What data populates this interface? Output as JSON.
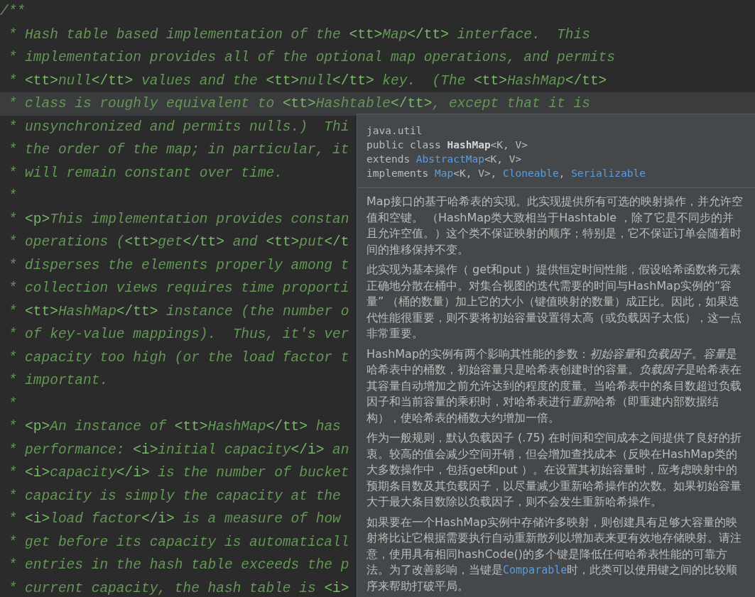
{
  "editor": {
    "lines": [
      {
        "current": false,
        "segments": [
          {
            "kind": "text",
            "text": "/**"
          }
        ]
      },
      {
        "current": false,
        "segments": [
          {
            "kind": "text",
            "text": " * Hash table based implementation of the "
          },
          {
            "kind": "tag",
            "text": "<tt>"
          },
          {
            "kind": "text",
            "text": "Map"
          },
          {
            "kind": "tag",
            "text": "</tt>"
          },
          {
            "kind": "text",
            "text": " interface.  This"
          }
        ]
      },
      {
        "current": false,
        "segments": [
          {
            "kind": "text",
            "text": " * implementation provides all of the optional map operations, and permits"
          }
        ]
      },
      {
        "current": false,
        "segments": [
          {
            "kind": "text",
            "text": " * "
          },
          {
            "kind": "tag",
            "text": "<tt>"
          },
          {
            "kind": "text",
            "text": "null"
          },
          {
            "kind": "tag",
            "text": "</tt>"
          },
          {
            "kind": "text",
            "text": " values and the "
          },
          {
            "kind": "tag",
            "text": "<tt>"
          },
          {
            "kind": "text",
            "text": "null"
          },
          {
            "kind": "tag",
            "text": "</tt>"
          },
          {
            "kind": "text",
            "text": " key.  (The "
          },
          {
            "kind": "tag",
            "text": "<tt>"
          },
          {
            "kind": "text",
            "text": "HashMap"
          },
          {
            "kind": "tag",
            "text": "</tt>"
          }
        ]
      },
      {
        "current": true,
        "segments": [
          {
            "kind": "text",
            "text": " * class is roughly equivalent to "
          },
          {
            "kind": "tag",
            "text": "<tt>"
          },
          {
            "kind": "text",
            "text": "Hashtable"
          },
          {
            "kind": "tag",
            "text": "</tt>"
          },
          {
            "kind": "text",
            "text": ", except that it is"
          }
        ]
      },
      {
        "current": false,
        "segments": [
          {
            "kind": "text",
            "text": " * unsynchronized and permits nulls.)  Thi"
          }
        ]
      },
      {
        "current": false,
        "segments": [
          {
            "kind": "text",
            "text": " * the order of the map; in particular, it"
          }
        ]
      },
      {
        "current": false,
        "segments": [
          {
            "kind": "text",
            "text": " * will remain constant over time."
          }
        ]
      },
      {
        "current": false,
        "segments": [
          {
            "kind": "text",
            "text": " *"
          }
        ]
      },
      {
        "current": false,
        "segments": [
          {
            "kind": "text",
            "text": " * "
          },
          {
            "kind": "tag",
            "text": "<p>"
          },
          {
            "kind": "text",
            "text": "This implementation provides constan"
          }
        ]
      },
      {
        "current": false,
        "segments": [
          {
            "kind": "text",
            "text": " * operations ("
          },
          {
            "kind": "tag",
            "text": "<tt>"
          },
          {
            "kind": "text",
            "text": "get"
          },
          {
            "kind": "tag",
            "text": "</tt>"
          },
          {
            "kind": "text",
            "text": " and "
          },
          {
            "kind": "tag",
            "text": "<tt>"
          },
          {
            "kind": "text",
            "text": "put"
          },
          {
            "kind": "tag",
            "text": "</t"
          }
        ]
      },
      {
        "current": false,
        "segments": [
          {
            "kind": "text",
            "text": " * disperses the elements properly among t"
          }
        ]
      },
      {
        "current": false,
        "segments": [
          {
            "kind": "text",
            "text": " * collection views requires time proporti"
          }
        ]
      },
      {
        "current": false,
        "segments": [
          {
            "kind": "text",
            "text": " * "
          },
          {
            "kind": "tag",
            "text": "<tt>"
          },
          {
            "kind": "text",
            "text": "HashMap"
          },
          {
            "kind": "tag",
            "text": "</tt>"
          },
          {
            "kind": "text",
            "text": " instance (the number o"
          }
        ]
      },
      {
        "current": false,
        "segments": [
          {
            "kind": "text",
            "text": " * of key-value mappings).  Thus, it's ver"
          }
        ]
      },
      {
        "current": false,
        "segments": [
          {
            "kind": "text",
            "text": " * capacity too high (or the load factor t"
          }
        ]
      },
      {
        "current": false,
        "segments": [
          {
            "kind": "text",
            "text": " * important."
          }
        ]
      },
      {
        "current": false,
        "segments": [
          {
            "kind": "text",
            "text": " *"
          }
        ]
      },
      {
        "current": false,
        "segments": [
          {
            "kind": "text",
            "text": " * "
          },
          {
            "kind": "tag",
            "text": "<p>"
          },
          {
            "kind": "text",
            "text": "An instance of "
          },
          {
            "kind": "tag",
            "text": "<tt>"
          },
          {
            "kind": "text",
            "text": "HashMap"
          },
          {
            "kind": "tag",
            "text": "</tt>"
          },
          {
            "kind": "text",
            "text": " has"
          }
        ]
      },
      {
        "current": false,
        "segments": [
          {
            "kind": "text",
            "text": " * performance: "
          },
          {
            "kind": "tag",
            "text": "<i>"
          },
          {
            "kind": "text",
            "text": "initial capacity"
          },
          {
            "kind": "tag",
            "text": "</i>"
          },
          {
            "kind": "text",
            "text": " an"
          }
        ]
      },
      {
        "current": false,
        "segments": [
          {
            "kind": "text",
            "text": " * "
          },
          {
            "kind": "tag",
            "text": "<i>"
          },
          {
            "kind": "text",
            "text": "capacity"
          },
          {
            "kind": "tag",
            "text": "</i>"
          },
          {
            "kind": "text",
            "text": " is the number of bucket"
          }
        ]
      },
      {
        "current": false,
        "segments": [
          {
            "kind": "text",
            "text": " * capacity is simply the capacity at the"
          }
        ]
      },
      {
        "current": false,
        "segments": [
          {
            "kind": "text",
            "text": " * "
          },
          {
            "kind": "tag",
            "text": "<i>"
          },
          {
            "kind": "text",
            "text": "load factor"
          },
          {
            "kind": "tag",
            "text": "</i>"
          },
          {
            "kind": "text",
            "text": " is a measure of how"
          }
        ]
      },
      {
        "current": false,
        "segments": [
          {
            "kind": "text",
            "text": " * get before its capacity is automaticall"
          }
        ]
      },
      {
        "current": false,
        "segments": [
          {
            "kind": "text",
            "text": " * entries in the hash table exceeds the p"
          }
        ]
      },
      {
        "current": false,
        "segments": [
          {
            "kind": "text",
            "text": " * current capacity, the hash table is "
          },
          {
            "kind": "tag",
            "text": "<i>"
          }
        ]
      }
    ]
  },
  "doc_popup": {
    "signature": [
      [
        {
          "kind": "plain",
          "text": "java.util"
        }
      ],
      [
        {
          "kind": "plain",
          "text": "public class "
        },
        {
          "kind": "bold",
          "text": "HashMap"
        },
        {
          "kind": "plain",
          "text": "<K, V>"
        }
      ],
      [
        {
          "kind": "plain",
          "text": "extends "
        },
        {
          "kind": "link",
          "text": "AbstractMap"
        },
        {
          "kind": "plain",
          "text": "<K, V>"
        }
      ],
      [
        {
          "kind": "plain",
          "text": "implements "
        },
        {
          "kind": "link",
          "text": "Map"
        },
        {
          "kind": "plain",
          "text": "<K, V>, "
        },
        {
          "kind": "link",
          "text": "Cloneable"
        },
        {
          "kind": "plain",
          "text": ", "
        },
        {
          "kind": "link",
          "text": "Serializable"
        }
      ]
    ],
    "paragraphs": [
      [
        {
          "kind": "text",
          "text": "Map接口的基于哈希表的实现。此实现提供所有可选的映射操作，并允许空值和空键。 （HashMap类大致相当于Hashtable ，除了它是不同步的并且允许空值。）这个类不保证映射的顺序；特别是，它不保证订单会随着时间的推移保持不变。"
        }
      ],
      [
        {
          "kind": "text",
          "text": "此实现为基本操作（ get和put ）提供恒定时间性能，假设哈希函数将元素正确地分散在桶中。对集合视图的迭代需要的时间与HashMap实例的“容量” （桶的数量）加上它的大小（键值映射的数量）成正比。因此，如果迭代性能很重要，则不要将初始容量设置得太高（或负载因子太低），这一点非常重要。"
        }
      ],
      [
        {
          "kind": "text",
          "text": "HashMap的实例有两个影响其性能的参数："
        },
        {
          "kind": "italic",
          "text": "初始容量"
        },
        {
          "kind": "text",
          "text": "和"
        },
        {
          "kind": "italic",
          "text": "负载因子"
        },
        {
          "kind": "text",
          "text": "。"
        },
        {
          "kind": "italic",
          "text": "容量"
        },
        {
          "kind": "text",
          "text": "是哈希表中的桶数，初始容量只是哈希表创建时的容量。"
        },
        {
          "kind": "italic",
          "text": "负载因子"
        },
        {
          "kind": "text",
          "text": "是哈希表在其容量自动增加之前允许达到的程度的度量。当哈希表中的条目数超过负载因子和当前容量的乘积时，对哈希表进行"
        },
        {
          "kind": "italic",
          "text": "重新"
        },
        {
          "kind": "text",
          "text": "哈希（即重建内部数据结构），使哈希表的桶数大约增加一倍。"
        }
      ],
      [
        {
          "kind": "text",
          "text": "作为一般规则，默认负载因子 (.75) 在时间和空间成本之间提供了良好的折衷。较高的值会减少空间开销，但会增加查找成本（反映在HashMap类的大多数操作中，包括get和put ）。在设置其初始容量时，应考虑映射中的预期条目数及其负载因子，以尽量减少重新哈希操作的次数。如果初始容量大于最大条目数除以负载因子，则不会发生重新哈希操作。"
        }
      ],
      [
        {
          "kind": "text",
          "text": "如果要在一个HashMap实例中存储许多映射，则创建具有足够大容量的映射将比让它根据需要执行自动重新散列以增加表来更有效地存储映射。请注意，使用具有相同hashCode()的多个键是降低任何哈希表性能的可靠方法。为了改善影响，当键是"
        },
        {
          "kind": "link",
          "text": "Comparable"
        },
        {
          "kind": "text",
          "text": "时，此类可以使用键之间的比较顺序来帮助打破平局。"
        }
      ]
    ]
  }
}
